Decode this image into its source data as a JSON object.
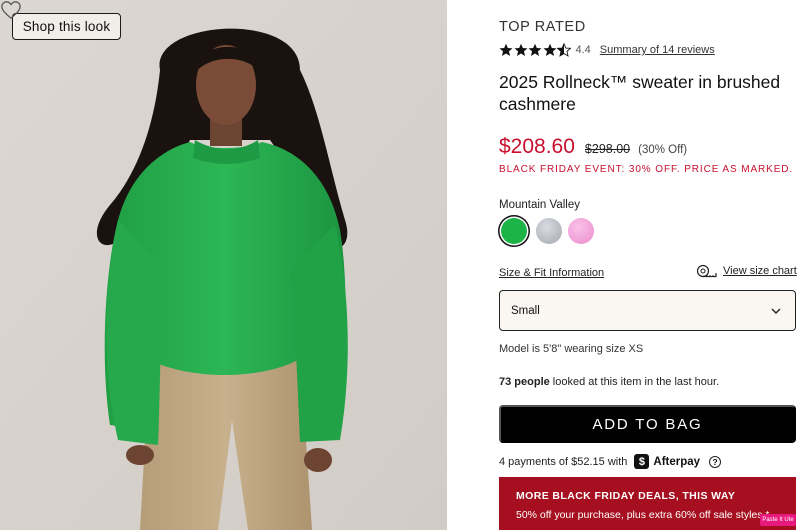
{
  "photo": {
    "shop_look_label": "Shop this look",
    "wishlist_icon": "heart-outline-icon"
  },
  "product": {
    "badge": "TOP RATED",
    "rating": "4.4",
    "rating_stars": 4.5,
    "reviews_link": "Summary of 14 reviews",
    "title": "2025 Rollneck™ sweater in brushed cashmere",
    "sale_price": "$208.60",
    "original_price": "$298.00",
    "discount": "(30% Off)",
    "event_text": "BLACK FRIDAY EVENT: 30% OFF. PRICE AS MARKED.",
    "color_name": "Mountain Valley",
    "swatches": [
      {
        "name": "green",
        "color": "#1db447",
        "selected": true
      },
      {
        "name": "grey",
        "color": "#b8bcc2",
        "selected": false
      },
      {
        "name": "pink",
        "color": "#f2a0d6",
        "selected": false
      }
    ],
    "size_fit_link": "Size & Fit Information",
    "size_chart_link": "View size chart",
    "size_chart_icon": "tape-measure-icon",
    "size_selected": "Small",
    "size_chevron_icon": "chevron-down-icon",
    "model_text": "Model is 5'8\" wearing size XS",
    "viewers_count": "73 people",
    "viewers_rest": " looked at this item in the last hour.",
    "add_to_bag": "ADD TO BAG",
    "afterpay_text": "4 payments of $52.15 with",
    "afterpay_logo_letter": "$",
    "afterpay_name": "Afterpay",
    "afterpay_help": "?"
  },
  "promo": {
    "heading": "MORE BLACK FRIDAY DEALS, THIS WAY",
    "sub": "50% off your purchase, plus extra 60% off sale styles.*"
  },
  "overlay_badge": "Paste It Ute",
  "colors": {
    "sale_red": "#c8102e",
    "promo_red": "#a50f1f",
    "button_black": "#000000",
    "photo_bg": "#d9d4cf",
    "sweater_green": "#22a84a",
    "pants_tan": "#c4ad8a"
  }
}
